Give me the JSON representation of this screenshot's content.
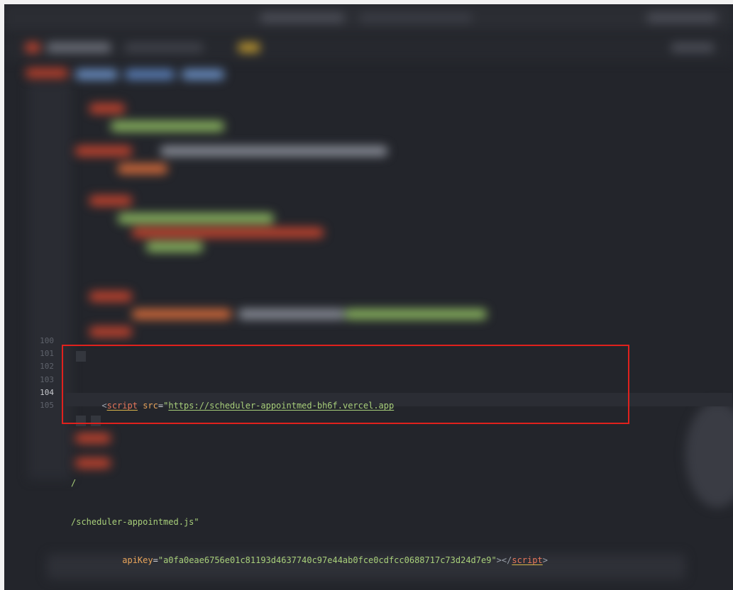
{
  "editor": {
    "line_numbers": [
      "100",
      "101",
      "102",
      "103",
      "104",
      "105"
    ],
    "active_line": "104",
    "code": {
      "line101": {
        "open_bracket": "<",
        "tag": "script",
        "attr_src": "src",
        "eq": "=",
        "src_open_quote": "\"",
        "src_url": "https://scheduler-appointmed-bh6f.vercel.app"
      },
      "line103": "/",
      "line104": "/scheduler-appointmed.js\"",
      "line105": {
        "attr_api": "apiKey",
        "eq": "=",
        "api_value": "\"a0fa0eae6756e01c81193d4637740c97e44ab0fce0cdfcc0688717c73d24d7e9\"",
        "close_open": "></",
        "close_tag": "script",
        "close_bracket": ">"
      }
    }
  },
  "colors": {
    "background": "#23252b",
    "highlight_border": "#e0211d",
    "tag": "#e8775a",
    "attribute": "#e8a45a",
    "string": "#a8cf7a"
  }
}
